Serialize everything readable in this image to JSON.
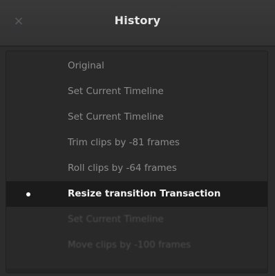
{
  "window": {
    "title": "History",
    "close_glyph": "×"
  },
  "history": {
    "current_index": 5,
    "items": [
      {
        "label": "Original",
        "state": "past"
      },
      {
        "label": "Set Current Timeline",
        "state": "past"
      },
      {
        "label": "Set Current Timeline",
        "state": "past"
      },
      {
        "label": "Trim clips by -81 frames",
        "state": "past"
      },
      {
        "label": "Roll clips by -64 frames",
        "state": "past"
      },
      {
        "label": "Resize transition Transaction",
        "state": "current"
      },
      {
        "label": "Set Current Timeline",
        "state": "future"
      },
      {
        "label": "Move clips by -100 frames",
        "state": "future"
      }
    ]
  },
  "colors": {
    "title_text": "#e6e6e6",
    "past_text": "#8c8c8e",
    "current_text": "#f2f2f2",
    "future_text": "#4e4e50",
    "current_row_bg": "#1b1b1c"
  }
}
